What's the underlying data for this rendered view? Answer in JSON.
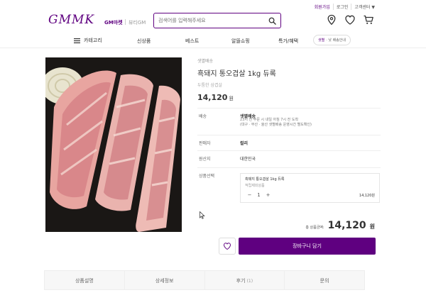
{
  "toplinks": [
    "회원가입",
    "로그인",
    "고객센터 ▼"
  ],
  "header": {
    "logo": "GMMK",
    "gm_market": "GM마켓",
    "gm_beauty": "뷰티GM",
    "search_placeholder": "검색어를 입력해주세요"
  },
  "icons": [
    "location-icon",
    "heart-icon",
    "cart-icon"
  ],
  "nav": {
    "category": "카테고리",
    "items": [
      "신상품",
      "베스트",
      "알뜰쇼핑",
      "특가/혜택"
    ],
    "delivery_badge": "샛별",
    "delivery_text": "· 낮 배송안내"
  },
  "product": {
    "shipping_tag": "샛별배송",
    "title": "흑돼지 통오겹살 1kg 듀록",
    "subtitle": "두툼한 삼겹살",
    "price": "14,120",
    "won": "원"
  },
  "details": {
    "delivery_label": "배송",
    "delivery_value": "샛별배송",
    "delivery_note1": "23시 전 주문 시 내일 아침 7시 전 도착",
    "delivery_note2": "(대구 · 부산 · 울산 샛별배송 운영시간 별도확인)",
    "seller_label": "판매자",
    "seller_value": "컬리",
    "origin_label": "원산지",
    "origin_value": "대한민국",
    "option_label": "상품선택"
  },
  "option": {
    "name": "흑돼지 통오겹살 1kg 듀록",
    "sub": "적립제외상품",
    "minus": "−",
    "qty": "1",
    "plus": "+",
    "price": "14,120원"
  },
  "total": {
    "label": "총 상품금액:",
    "amount": "14,120",
    "won": "원"
  },
  "buttons": {
    "cart": "장바구니 담기"
  },
  "tabs": [
    {
      "label": "상품설명",
      "count": ""
    },
    {
      "label": "상세정보",
      "count": ""
    },
    {
      "label": "후기",
      "count": "(1)"
    },
    {
      "label": "문의",
      "count": ""
    }
  ],
  "colors": {
    "brand": "#5f0080"
  }
}
